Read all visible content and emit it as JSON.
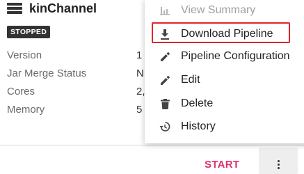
{
  "card": {
    "title": "kinChannel",
    "status": "STOPPED",
    "properties": [
      {
        "label": "Version",
        "value": "1"
      },
      {
        "label": "Jar Merge Status",
        "value": "N"
      },
      {
        "label": "Cores",
        "value": "2,"
      },
      {
        "label": "Memory",
        "value": "5"
      }
    ],
    "start_label": "START",
    "more_icon": "more-vert-icon"
  },
  "menu": {
    "items": [
      {
        "label": "View Summary",
        "icon": "bar-chart-icon",
        "disabled": true
      },
      {
        "label": "Download Pipeline",
        "icon": "download-icon",
        "highlighted": true,
        "highlight_color": "#e0242b"
      },
      {
        "label": "Pipeline Configuration",
        "icon": "pencil-icon"
      },
      {
        "label": "Edit",
        "icon": "pencil-icon"
      },
      {
        "label": "Delete",
        "icon": "trash-icon"
      },
      {
        "label": "History",
        "icon": "history-icon"
      }
    ]
  },
  "colors": {
    "accent": "#e0306e",
    "badge_bg": "#333333"
  }
}
